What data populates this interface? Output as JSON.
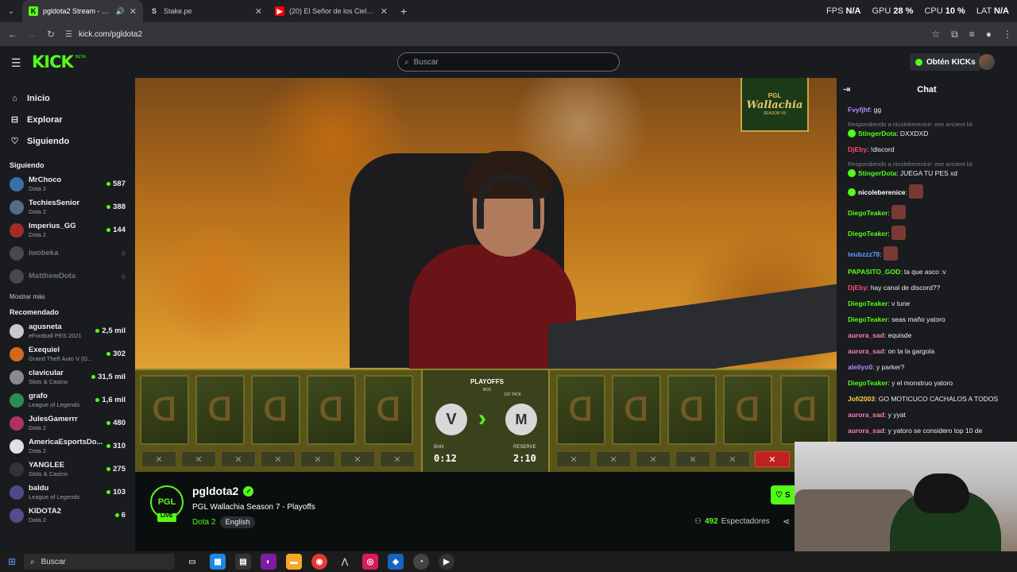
{
  "browser": {
    "tabs": [
      {
        "title": "pgldota2 Stream - Watch Live on Kick",
        "favicon": "K",
        "favicon_color": "#53fc18",
        "active": true
      },
      {
        "title": "Stake.pe",
        "favicon": "S",
        "favicon_color": "#cfd8dc",
        "active": false
      },
      {
        "title": "(20) El Señor de los Cielos 5 | Capítulo",
        "favicon": "▶",
        "favicon_color": "#ff0000",
        "active": false
      }
    ],
    "url": "kick.com/pgldota2",
    "stats": {
      "fps_label": "FPS",
      "fps": "N/A",
      "gpu_label": "GPU",
      "gpu": "28 %",
      "cpu_label": "CPU",
      "cpu": "10 %",
      "lat_label": "LAT",
      "lat": "N/A"
    }
  },
  "topnav": {
    "logo": "KICK",
    "beta": "BETA",
    "search_placeholder": "Buscar",
    "kicks_label": "Obtén KICKs"
  },
  "sidebar": {
    "main": [
      {
        "label": "Inicio",
        "icon": "home-icon"
      },
      {
        "label": "Explorar",
        "icon": "compass-icon"
      },
      {
        "label": "Siguiendo",
        "icon": "heart-icon"
      }
    ],
    "following_title": "Siguiendo",
    "following": [
      {
        "name": "MrChoco",
        "game": "Dota 2",
        "viewers": "587",
        "color": "#3a6ea5"
      },
      {
        "name": "TechiesSenior",
        "game": "Dota 2",
        "viewers": "388",
        "color": "#556b8a"
      },
      {
        "name": "Imperius_GG",
        "game": "Dota 2",
        "viewers": "144",
        "color": "#a52a2a"
      },
      {
        "name": "iwobeka",
        "game": "",
        "viewers": "",
        "color": "#777777"
      },
      {
        "name": "MatthewDota",
        "game": "",
        "viewers": "",
        "color": "#777777"
      }
    ],
    "show_more": "Mostrar más",
    "recommended_title": "Recomendado",
    "recommended": [
      {
        "name": "agusneta",
        "game": "eFootball PES 2021",
        "viewers": "2,5 mil",
        "color": "#c9c9c9"
      },
      {
        "name": "Exequiel",
        "game": "Grand Theft Auto V (G...",
        "viewers": "302",
        "color": "#d2691e"
      },
      {
        "name": "clavicular",
        "game": "Slots & Casino",
        "viewers": "31,5 mil",
        "color": "#8a8a8a"
      },
      {
        "name": "grafo",
        "game": "League of Legends",
        "viewers": "1,6 mil",
        "color": "#2e8b57"
      },
      {
        "name": "JulesGamerrr",
        "game": "Dota 2",
        "viewers": "480",
        "color": "#b03060"
      },
      {
        "name": "AmericaEsportsDo...",
        "game": "Dota 2",
        "viewers": "310",
        "color": "#e0e0e0"
      },
      {
        "name": "YANGLEE",
        "game": "Slots & Casino",
        "viewers": "275",
        "color": "#333333"
      },
      {
        "name": "baldu",
        "game": "League of Legends",
        "viewers": "103",
        "color": "#4a4a8a"
      },
      {
        "name": "KIDOTA2",
        "game": "Dota 2",
        "viewers": "6",
        "color": "#5a4a8a"
      }
    ]
  },
  "player": {
    "overlay_brand": "PGL",
    "overlay_event": "Wallachia",
    "overlay_season": "SEASON VII",
    "draft": {
      "phase": "PLAYOFFS",
      "series": "BO3",
      "first_pick": "1ST PICK",
      "team_left": "V",
      "team_right": "M",
      "ban_label": "BAN",
      "ban_time": "0:12",
      "reserve_label": "RESERVE",
      "reserve_time": "2:10",
      "slot_mark": "✕"
    }
  },
  "stream": {
    "channel": "pgldota2",
    "logo_text": "PGL",
    "live": "LIVE",
    "title": "PGL Wallachia Season 7 - Playoffs",
    "category": "Dota 2",
    "language": "English",
    "viewers": "492",
    "viewers_label": "Espectadores",
    "follow_label": "S"
  },
  "chat": {
    "title": "Chat",
    "messages": [
      {
        "user": "Fvyfjhf",
        "color": "#b18cff",
        "text": "gg",
        "reply": "",
        "badge": false
      },
      {
        "user": "StingerDota",
        "color": "#53fc18",
        "text": "DXXDXD",
        "reply": "Respondiendo a nicoleberenice: ese ancient kk",
        "badge": true
      },
      {
        "user": "DjEby",
        "color": "#ff4d6d",
        "text": "!discord",
        "reply": "",
        "badge": false
      },
      {
        "user": "StingerDota",
        "color": "#53fc18",
        "text": "JUEGA TU PES xd",
        "reply": "Respondiendo a nicoleberenice: ese ancient kk",
        "badge": true
      },
      {
        "user": "nicoleberenice",
        "color": "#ffffff",
        "text": "",
        "reply": "",
        "badge": true
      },
      {
        "user": "DiegoTeaker",
        "color": "#53fc18",
        "text": "",
        "reply": "",
        "badge": false
      },
      {
        "user": "DiegoTeaker",
        "color": "#53fc18",
        "text": "",
        "reply": "",
        "badge": false
      },
      {
        "user": "teubzzz78",
        "color": "#5aa0ff",
        "text": "",
        "reply": "",
        "badge": false
      },
      {
        "user": "PAPASITO_GOD",
        "color": "#53fc18",
        "text": "ta que asco :v",
        "reply": "",
        "badge": false
      },
      {
        "user": "DjEby",
        "color": "#ff4d6d",
        "text": "hay canal de discord??",
        "reply": "",
        "badge": false
      },
      {
        "user": "DiegoTeaker",
        "color": "#53fc18",
        "text": "v tune",
        "reply": "",
        "badge": false
      },
      {
        "user": "DiegoTeaker",
        "color": "#53fc18",
        "text": "seas maño yatoro",
        "reply": "",
        "badge": false
      },
      {
        "user": "aurora_sad",
        "color": "#ff7eb6",
        "text": "equisde",
        "reply": "",
        "badge": false
      },
      {
        "user": "aurora_sad",
        "color": "#ff7eb6",
        "text": "on ta la gargola",
        "reply": "",
        "badge": false
      },
      {
        "user": "aleliyo0",
        "color": "#b18cff",
        "text": "y parker?",
        "reply": "",
        "badge": false
      },
      {
        "user": "DiegoTeaker",
        "color": "#53fc18",
        "text": "y el monstruo yatoro",
        "reply": "",
        "badge": false
      },
      {
        "user": "Jofi2003",
        "color": "#ffd34d",
        "text": "GO MOTICUCO CACHALOS A TODOS",
        "reply": "",
        "badge": false
      },
      {
        "user": "aurora_sad",
        "color": "#ff7eb6",
        "text": "y yyat",
        "reply": "",
        "badge": false
      },
      {
        "user": "aurora_sad",
        "color": "#ff7eb6",
        "text": "y yatoro se considero top 10 de",
        "reply": "",
        "badge": false
      }
    ]
  },
  "taskbar": {
    "search": "Buscar"
  }
}
